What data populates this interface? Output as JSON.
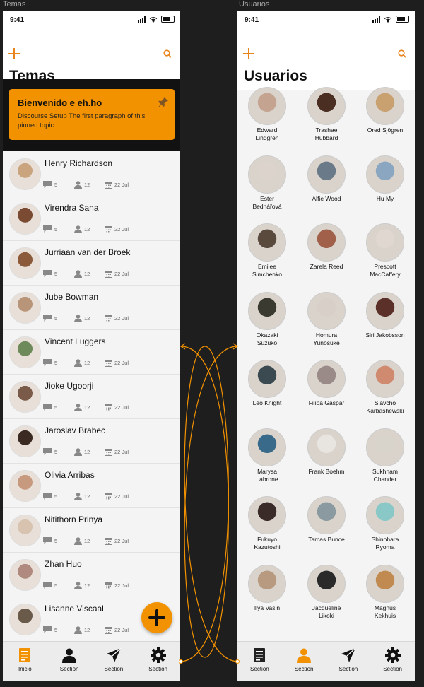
{
  "canvas": {
    "label_left": "Temas",
    "label_right": "Usuarios"
  },
  "status_bar": {
    "time": "9:41"
  },
  "colors": {
    "accent": "#f39200",
    "accent_dark": "#e8841c"
  },
  "temas": {
    "title": "Temas",
    "pinned": {
      "title": "Bienvenido e eh.ho",
      "body": "Discourse Setup The first paragraph of this pinned topic…"
    },
    "topics": [
      {
        "name": "Henry Richardson",
        "replies": "5",
        "users": "12",
        "date": "22 Jul",
        "avatar": "#c9a47e"
      },
      {
        "name": "Virendra Sana",
        "replies": "5",
        "users": "12",
        "date": "22 Jul",
        "avatar": "#7a4a32"
      },
      {
        "name": "Jurriaan van der Broek",
        "replies": "5",
        "users": "12",
        "date": "22 Jul",
        "avatar": "#8a5a3a"
      },
      {
        "name": "Jube Bowman",
        "replies": "5",
        "users": "12",
        "date": "22 Jul",
        "avatar": "#b89478"
      },
      {
        "name": "Vincent Luggers",
        "replies": "5",
        "users": "12",
        "date": "22 Jul",
        "avatar": "#6f8a5a"
      },
      {
        "name": "Jioke Ugoorji",
        "replies": "5",
        "users": "12",
        "date": "22 Jul",
        "avatar": "#7a5a48"
      },
      {
        "name": "Jaroslav Brabec",
        "replies": "5",
        "users": "12",
        "date": "22 Jul",
        "avatar": "#3a2a22"
      },
      {
        "name": "Olivia Arribas",
        "replies": "5",
        "users": "12",
        "date": "22 Jul",
        "avatar": "#c79a80"
      },
      {
        "name": "Nitithorn Prinya",
        "replies": "5",
        "users": "12",
        "date": "22 Jul",
        "avatar": "#d7c3b0"
      },
      {
        "name": "Zhan Huo",
        "replies": "5",
        "users": "12",
        "date": "22 Jul",
        "avatar": "#b08a7e"
      },
      {
        "name": "Lisanne Viscaal",
        "replies": "5",
        "users": "12",
        "date": "22 Jul",
        "avatar": "#6a5a4a"
      }
    ],
    "tabs": [
      {
        "label": "Inicio",
        "icon": "document-icon",
        "active": true
      },
      {
        "label": "Section",
        "icon": "person-icon",
        "active": false
      },
      {
        "label": "Section",
        "icon": "send-icon",
        "active": false
      },
      {
        "label": "Section",
        "icon": "gear-icon",
        "active": false
      }
    ]
  },
  "usuarios": {
    "title": "Usuarios",
    "users": [
      {
        "name": "Edward\nLindgren",
        "avatar": "#c4a490"
      },
      {
        "name": "Trashae\nHubbard",
        "avatar": "#4a2e22"
      },
      {
        "name": "Ored Sjögren",
        "avatar": "#c9a070"
      },
      {
        "name": "Ester\nBednářová",
        "avatar": "#dcd4cc"
      },
      {
        "name": "Alfie Wood",
        "avatar": "#6a7a88"
      },
      {
        "name": "Hu My",
        "avatar": "#8aa6c0"
      },
      {
        "name": "Emilee\nSimchenko",
        "avatar": "#5a4a3e"
      },
      {
        "name": "Zarela Reed",
        "avatar": "#a0604a"
      },
      {
        "name": "Prescott\nMacCaffery",
        "avatar": "#e0d8d0"
      },
      {
        "name": "Okazaki\nSuzuko",
        "avatar": "#3a3a30"
      },
      {
        "name": "Homura\nYunosuke",
        "avatar": "#d8d0c8"
      },
      {
        "name": "Siri Jakobsson",
        "avatar": "#5a3028"
      },
      {
        "name": "Leo Knight",
        "avatar": "#3a4a50"
      },
      {
        "name": "Filipa Gaspar",
        "avatar": "#9a8a88"
      },
      {
        "name": "Slavcho\nKarbashewski",
        "avatar": "#d08a70"
      },
      {
        "name": "Marysa\nLabrone",
        "avatar": "#3a6a8a"
      },
      {
        "name": "Frank Boehm",
        "avatar": "#e8e4e0"
      },
      {
        "name": "Sukhnam\nChander",
        "avatar": "#d8d4cc"
      },
      {
        "name": "Fukuyo\nKazutoshi",
        "avatar": "#3a2a28"
      },
      {
        "name": "Tamas Bunce",
        "avatar": "#8a9aa0"
      },
      {
        "name": "Shinohara\nRyoma",
        "avatar": "#8ac8c8"
      },
      {
        "name": "Ilya Vasin",
        "avatar": "#b89a80"
      },
      {
        "name": "Jacqueline\nLikoki",
        "avatar": "#2a2a2a"
      },
      {
        "name": "Magnus\nKekhuis",
        "avatar": "#c08a50"
      }
    ],
    "tabs": [
      {
        "label": "Section",
        "icon": "document-icon",
        "active": false
      },
      {
        "label": "Section",
        "icon": "person-icon",
        "active": true
      },
      {
        "label": "Section",
        "icon": "send-icon",
        "active": false
      },
      {
        "label": "Section",
        "icon": "gear-icon",
        "active": false
      }
    ]
  }
}
